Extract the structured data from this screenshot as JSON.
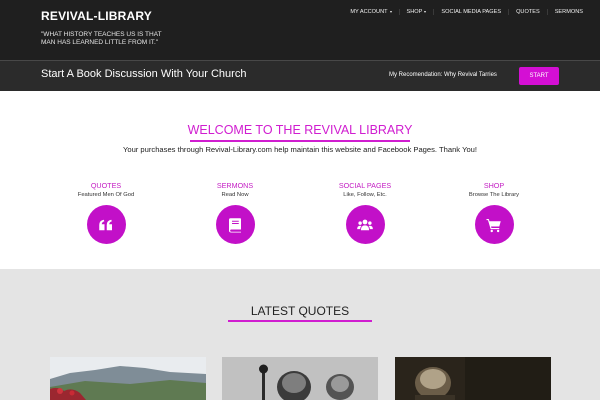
{
  "header": {
    "brand": "REVIVAL-LIBRARY",
    "tagline": "\"WHAT HISTORY TEACHES US IS THAT MAN HAS LEARNED LITTLE FROM IT.\"",
    "nav": [
      {
        "label": "MY ACCOUNT",
        "dropdown": true
      },
      {
        "label": "SHOP",
        "dropdown": true
      },
      {
        "label": "SOCIAL MEDIA PAGES",
        "dropdown": false
      },
      {
        "label": "QUOTES",
        "dropdown": false
      },
      {
        "label": "SERMONS",
        "dropdown": false
      }
    ]
  },
  "banner": {
    "title": "Start A Book Discussion With Your Church",
    "recommendation": "My Recomendation: Why Revival Tarries",
    "button": "START"
  },
  "welcome": {
    "title": "WELCOME TO THE REVIVAL LIBRARY",
    "subtitle": "Your purchases through Revival-Library.com help maintain this website and Facebook Pages. Thank You!",
    "features": [
      {
        "title": "QUOTES",
        "subtitle": "Featured Men Of God",
        "icon": "quote-icon"
      },
      {
        "title": "SERMONS",
        "subtitle": "Read Now",
        "icon": "book-icon"
      },
      {
        "title": "SOCIAL PAGES",
        "subtitle": "Like, Follow, Etc.",
        "icon": "users-icon"
      },
      {
        "title": "SHOP",
        "subtitle": "Browse The Library",
        "icon": "cart-icon"
      }
    ]
  },
  "latest": {
    "title": "LATEST QUOTES"
  },
  "colors": {
    "accent": "#d01dd0",
    "header_bg": "#1f1f1f",
    "bar_bg": "#2b2b2b",
    "section_bg": "#e4e4e4"
  }
}
